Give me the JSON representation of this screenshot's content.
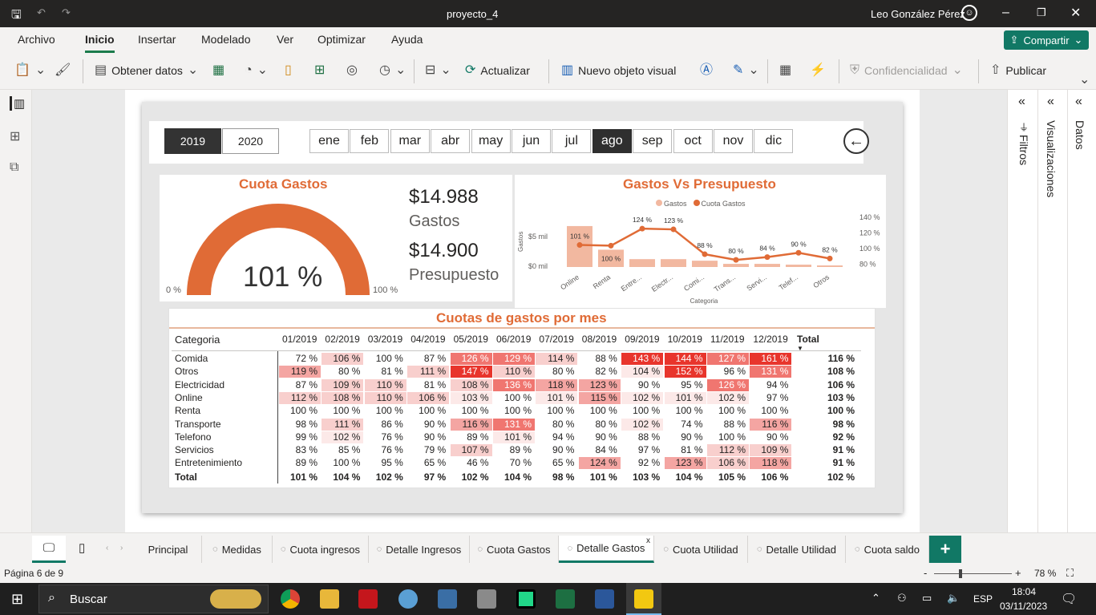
{
  "window": {
    "title": "proyecto_4",
    "user": "Leo González Pérez"
  },
  "menu": [
    "Archivo",
    "Inicio",
    "Insertar",
    "Modelado",
    "Ver",
    "Optimizar",
    "Ayuda"
  ],
  "menu_active": "Inicio",
  "share_label": "Compartir",
  "ribbon": {
    "get_data": "Obtener datos",
    "refresh": "Actualizar",
    "new_visual": "Nuevo objeto visual",
    "sensitivity": "Confidencialidad",
    "publish": "Publicar"
  },
  "panes": {
    "filters": "Filtros",
    "visualizations": "Visualizaciones",
    "data": "Datos"
  },
  "years": [
    "2019",
    "2020"
  ],
  "selected_year": "2019",
  "months": [
    "ene",
    "feb",
    "mar",
    "abr",
    "may",
    "jun",
    "jul",
    "ago",
    "sep",
    "oct",
    "nov",
    "dic"
  ],
  "selected_month": "ago",
  "gauge": {
    "title": "Cuota Gastos",
    "value": "101 %",
    "min": "0 %",
    "max": "100 %",
    "fraction": 1.0,
    "color": "#e06b36"
  },
  "kpi": {
    "gastos_value": "$14.988",
    "gastos_label": "Gastos",
    "presupuesto_value": "$14.900",
    "presupuesto_label": "Presupuesto"
  },
  "combo": {
    "title": "Gastos Vs Presupuesto",
    "legend": [
      "Gastos",
      "Cuota Gastos"
    ],
    "y_left_ticks": [
      "$5 mil",
      "$0 mil"
    ],
    "y_left_label": "Gastos",
    "y_right_ticks": [
      "140 %",
      "120 %",
      "100 %",
      "80 %"
    ],
    "x_label": "Categoria"
  },
  "chart_data": {
    "type": "bar",
    "categories": [
      "Online",
      "Renta",
      "Entre...",
      "Electr...",
      "Comi...",
      "Trans...",
      "Servi...",
      "Telef...",
      "Otros"
    ],
    "series": [
      {
        "name": "Gastos",
        "type": "bar",
        "values": [
          5.2,
          2.2,
          1.0,
          1.0,
          0.8,
          0.4,
          0.4,
          0.3,
          0.2
        ]
      },
      {
        "name": "Cuota Gastos",
        "type": "line",
        "values": [
          101,
          100,
          124,
          123,
          88,
          80,
          84,
          90,
          82
        ],
        "labels": [
          "101 %",
          "100 %",
          "124 %",
          "123 %",
          "88 %",
          "80 %",
          "84 %",
          "90 %",
          "82 %"
        ]
      }
    ],
    "title": "Gastos Vs Presupuesto",
    "xlabel": "Categoria",
    "ylabel": "Gastos",
    "y2lim": [
      70,
      140
    ]
  },
  "matrix": {
    "title": "Cuotas de gastos por mes",
    "header_cat": "Categoria",
    "columns": [
      "01/2019",
      "02/2019",
      "03/2019",
      "04/2019",
      "05/2019",
      "06/2019",
      "07/2019",
      "08/2019",
      "09/2019",
      "10/2019",
      "11/2019",
      "12/2019"
    ],
    "total_header": "Total",
    "rows": [
      {
        "cat": "Comida",
        "vals": [
          72,
          106,
          100,
          87,
          126,
          129,
          114,
          88,
          143,
          144,
          127,
          161
        ],
        "total": "116 %"
      },
      {
        "cat": "Otros",
        "vals": [
          119,
          80,
          81,
          111,
          147,
          110,
          80,
          82,
          104,
          152,
          96,
          131
        ],
        "total": "108 %"
      },
      {
        "cat": "Electricidad",
        "vals": [
          87,
          109,
          110,
          81,
          108,
          136,
          118,
          123,
          90,
          95,
          126,
          94
        ],
        "total": "106 %"
      },
      {
        "cat": "Online",
        "vals": [
          112,
          108,
          110,
          106,
          103,
          100,
          101,
          115,
          102,
          101,
          102,
          97
        ],
        "total": "103 %"
      },
      {
        "cat": "Renta",
        "vals": [
          100,
          100,
          100,
          100,
          100,
          100,
          100,
          100,
          100,
          100,
          100,
          100
        ],
        "total": "100 %"
      },
      {
        "cat": "Transporte",
        "vals": [
          98,
          111,
          86,
          90,
          116,
          131,
          80,
          80,
          102,
          74,
          88,
          116
        ],
        "total": "98 %"
      },
      {
        "cat": "Telefono",
        "vals": [
          99,
          102,
          76,
          90,
          89,
          101,
          94,
          90,
          88,
          90,
          100,
          90
        ],
        "total": "92 %"
      },
      {
        "cat": "Servicios",
        "vals": [
          83,
          85,
          76,
          79,
          107,
          89,
          90,
          84,
          97,
          81,
          112,
          109
        ],
        "total": "91 %"
      },
      {
        "cat": "Entretenimiento",
        "vals": [
          89,
          100,
          95,
          65,
          46,
          70,
          65,
          124,
          92,
          123,
          106,
          118
        ],
        "total": "91 %"
      }
    ],
    "total_row": {
      "cat": "Total",
      "vals": [
        "101 %",
        "104 %",
        "102 %",
        "97 %",
        "102 %",
        "104 %",
        "98 %",
        "101 %",
        "103 %",
        "104 %",
        "105 %",
        "106 %"
      ],
      "total": "102 %"
    }
  },
  "tabs": [
    "Principal",
    "Medidas",
    "Cuota ingresos",
    "Detalle Ingresos",
    "Cuota Gastos",
    "Detalle Gastos",
    "Cuota Utilidad",
    "Detalle Utilidad",
    "Cuota saldo"
  ],
  "selected_tab": "Detalle Gastos",
  "status": {
    "page": "Página 6 de 9",
    "zoom": "78 %"
  },
  "taskbar": {
    "search": "Buscar",
    "lang": "ESP",
    "time": "18:04",
    "date": "03/11/2023"
  }
}
